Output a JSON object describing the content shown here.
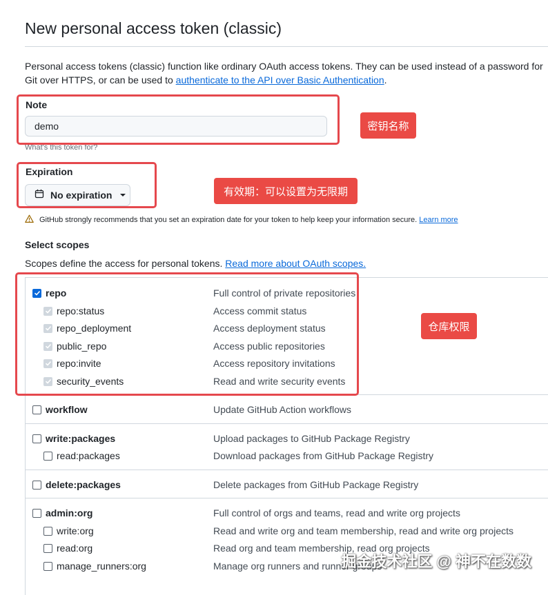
{
  "page": {
    "title": "New personal access token (classic)",
    "description_before_link": "Personal access tokens (classic) function like ordinary OAuth access tokens. They can be used instead of a password for Git over HTTPS, or can be used to ",
    "description_link": "authenticate to the API over Basic Authentication",
    "description_after_link": "."
  },
  "note": {
    "label": "Note",
    "value": "demo",
    "hint": "What's this token for?"
  },
  "expiration": {
    "label": "Expiration",
    "selected": "No expiration",
    "warning": "GitHub strongly recommends that you set an expiration date for your token to help keep your information secure.",
    "warning_link": "Learn more"
  },
  "scopes": {
    "heading": "Select scopes",
    "desc_text": "Scopes define the access for personal tokens. ",
    "desc_link": "Read more about OAuth scopes.",
    "repo": {
      "name": "repo",
      "desc": "Full control of private repositories"
    },
    "repo_status": {
      "name": "repo:status",
      "desc": "Access commit status"
    },
    "repo_deployment": {
      "name": "repo_deployment",
      "desc": "Access deployment status"
    },
    "public_repo": {
      "name": "public_repo",
      "desc": "Access public repositories"
    },
    "repo_invite": {
      "name": "repo:invite",
      "desc": "Access repository invitations"
    },
    "security_events": {
      "name": "security_events",
      "desc": "Read and write security events"
    },
    "workflow": {
      "name": "workflow",
      "desc": "Update GitHub Action workflows"
    },
    "write_packages": {
      "name": "write:packages",
      "desc": "Upload packages to GitHub Package Registry"
    },
    "read_packages": {
      "name": "read:packages",
      "desc": "Download packages from GitHub Package Registry"
    },
    "delete_packages": {
      "name": "delete:packages",
      "desc": "Delete packages from GitHub Package Registry"
    },
    "admin_org": {
      "name": "admin:org",
      "desc": "Full control of orgs and teams, read and write org projects"
    },
    "write_org": {
      "name": "write:org",
      "desc": "Read and write org and team membership, read and write org projects"
    },
    "read_org": {
      "name": "read:org",
      "desc": "Read org and team membership, read org projects"
    },
    "manage_runners_org": {
      "name": "manage_runners:org",
      "desc": "Manage org runners and runner groups"
    }
  },
  "annotations": {
    "note_badge": "密钥名称",
    "expiration_badge": "有效期：可以设置为无限期",
    "repo_badge": "仓库权限"
  },
  "watermark": "掘金技术社区 @ 神不在数数",
  "colors": {
    "accent": "#0969da",
    "annotation_red": "#e5484d",
    "border": "#d0d7de"
  }
}
